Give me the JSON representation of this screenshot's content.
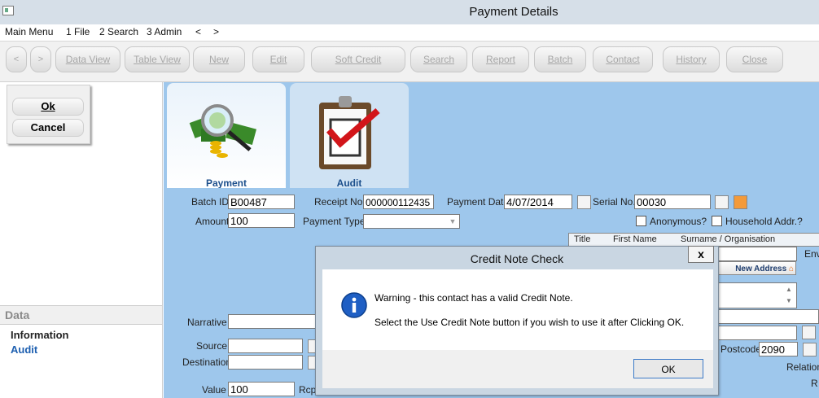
{
  "window": {
    "title": "Payment Details"
  },
  "menu": [
    "Main Menu",
    "1 File",
    "2 Search",
    "3 Admin",
    "<",
    ">"
  ],
  "toolbar": {
    "nav_back": "<",
    "nav_forward": ">",
    "buttons": [
      "Data View",
      "Table View",
      "New",
      "Edit",
      "Soft Credit",
      "Search",
      "Report",
      "Batch",
      "Contact",
      "History",
      "Close"
    ]
  },
  "left": {
    "ok": "Ok",
    "cancel": "Cancel",
    "data_header": "Data",
    "links": [
      "Information",
      "Audit"
    ]
  },
  "tabs": [
    {
      "label": "Payment"
    },
    {
      "label": "Audit"
    }
  ],
  "form": {
    "batch_id_label": "Batch ID",
    "batch_id": "B00487",
    "receipt_label": "Receipt No.",
    "receipt": "000000112435",
    "payment_date_label": "Payment Date",
    "payment_date": "4/07/2014",
    "serial_label": "Serial No.",
    "serial": "00030",
    "amount_label": "Amount",
    "amount": "100",
    "payment_type_label": "Payment Type",
    "payment_type": "",
    "anonymous_label": "Anonymous?",
    "household_label": "Household Addr.?",
    "title_col": "Title",
    "first_name_col": "First Name",
    "surname_col": "Surname / Organisation",
    "env_label": "Env",
    "new_address": "New Address",
    "narrative_label": "Narrative",
    "source_label": "Source",
    "destination_label": "Destination",
    "value_label": "Value",
    "value": "100",
    "rcpt_label": "Rcpt",
    "postcode_label": "Postcode",
    "postcode": "2090",
    "relation_label": "Relation",
    "r_label": "R"
  },
  "dialog": {
    "title": "Credit Note Check",
    "close": "x",
    "line1": "Warning - this contact has a valid Credit Note.",
    "line2": "Select the Use Credit Note button if you wish to use it after Clicking OK.",
    "ok": "OK"
  }
}
